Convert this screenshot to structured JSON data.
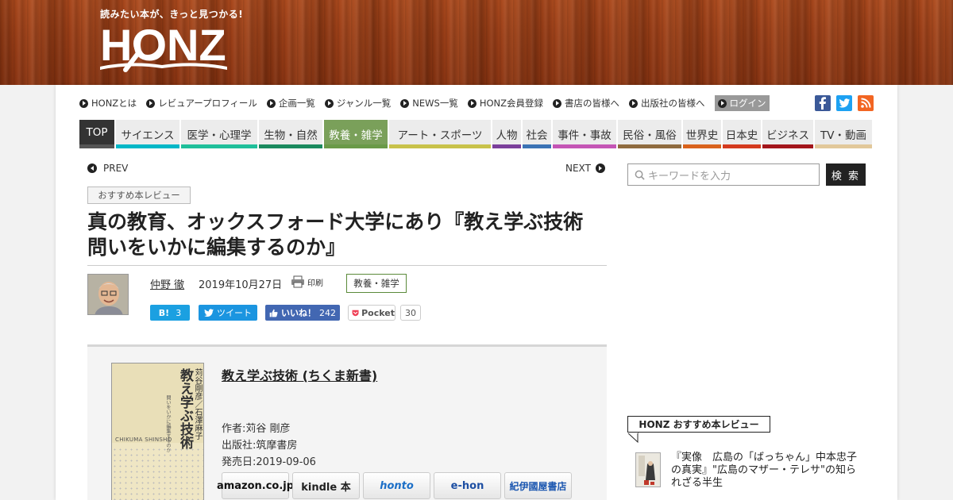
{
  "header": {
    "tagline": "読みたい本が、きっと見つかる!",
    "logo_text": "HONZ"
  },
  "topnav": {
    "items": [
      {
        "label": "HONZとは"
      },
      {
        "label": "レビュアープロフィール"
      },
      {
        "label": "企画一覧"
      },
      {
        "label": "ジャンル一覧"
      },
      {
        "label": "NEWS一覧"
      },
      {
        "label": "HONZ会員登録"
      },
      {
        "label": "書店の皆様へ"
      },
      {
        "label": "出版社の皆様へ"
      },
      {
        "label": "ログイン"
      }
    ],
    "social": [
      {
        "icon": "facebook-icon",
        "glyph": "f",
        "color": "#3b5998"
      },
      {
        "icon": "twitter-icon",
        "glyph": "t",
        "color": "#1da1f2"
      },
      {
        "icon": "rss-icon",
        "glyph": "r",
        "color": "#f26522"
      }
    ]
  },
  "genres": [
    {
      "label": "TOP",
      "color": "#555555"
    },
    {
      "label": "サイエンス",
      "color": "#00b7c7"
    },
    {
      "label": "医学・心理学",
      "color": "#1fbf9a"
    },
    {
      "label": "生物・自然",
      "color": "#1a8a5e"
    },
    {
      "label": "教養・雑学",
      "color": "#6a9a48"
    },
    {
      "label": "アート・スポーツ",
      "color": "#c8c24a"
    },
    {
      "label": "人物",
      "color": "#7b3f9b"
    },
    {
      "label": "社会",
      "color": "#3b73b5"
    },
    {
      "label": "事件・事故",
      "color": "#c455b5"
    },
    {
      "label": "民俗・風俗",
      "color": "#8f6b3e"
    },
    {
      "label": "世界史",
      "color": "#d9621c"
    },
    {
      "label": "日本史",
      "color": "#d43a1e"
    },
    {
      "label": "ビジネス",
      "color": "#a3151a"
    },
    {
      "label": "TV・動画",
      "color": "#e2c89a"
    }
  ],
  "article": {
    "prev_label": "PREV",
    "next_label": "NEXT",
    "category_label": "おすすめ本レビュー",
    "title": "真の教育、オックスフォード大学にあり『教え学ぶ技術　問いをいかに編集するのか』",
    "author": "仲野 徹",
    "date": "2019年10月27日",
    "print_label": "印刷",
    "genre_tag": "教養・雑学",
    "share": {
      "hatena_label": "B!",
      "hatena_count": "3",
      "tweet_label": "ツイート",
      "like_label": "いいね！",
      "like_count": "242",
      "pocket_label": "Pocket",
      "pocket_count": "30"
    }
  },
  "book": {
    "title": "教え学ぶ技術 (ちくま新書)",
    "author_line": "作者:苅谷 剛彦",
    "publisher_line": "出版社:筑摩書房",
    "date_line": "発売日:2019-09-06",
    "cover": {
      "title": "教え学ぶ技術",
      "authors": "苅谷剛彦／石澤麻子",
      "subtitle": "問いをいかに編集するのか",
      "series": "CHIKUMA SHINSHO"
    },
    "stores": [
      {
        "label": "amazon.co.jp",
        "color": "#111111"
      },
      {
        "label": "kindle 本",
        "color": "#222222"
      },
      {
        "label": "honto",
        "color": "#1c6fc7"
      },
      {
        "label": "e-hon",
        "color": "#1d4fa3"
      },
      {
        "label": "紀伊國屋書店",
        "color": "#1c57b0"
      }
    ]
  },
  "sidebar": {
    "search_placeholder": "キーワードを入力",
    "search_button": "検 索",
    "rec_heading": "HONZ おすすめ本レビュー",
    "rec_item_title": "『実像　広島の「ばっちゃん」中本忠子の真実』\"広島のマザー・テレサ\"の知られざる半生"
  }
}
